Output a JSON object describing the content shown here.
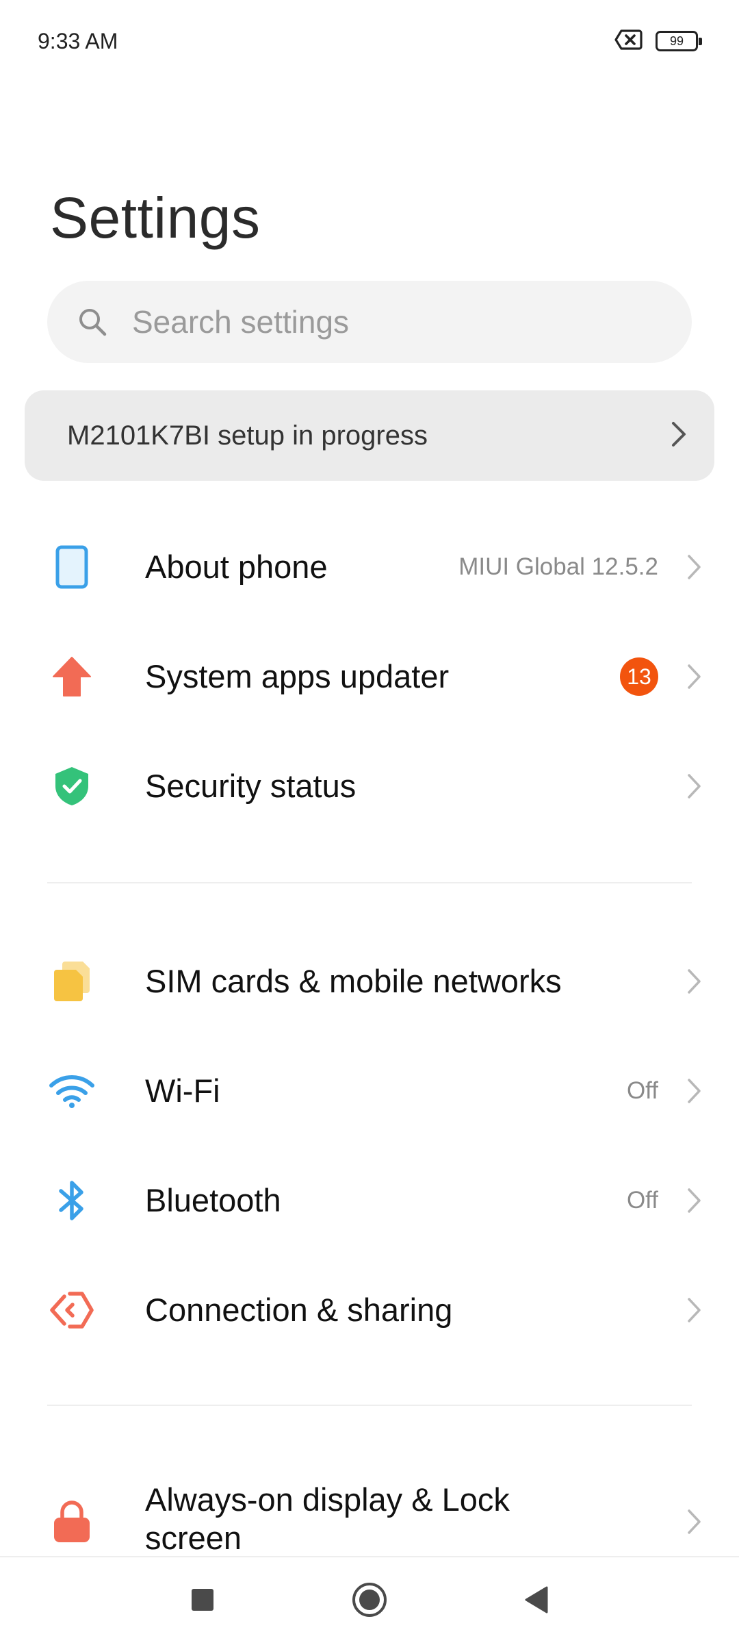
{
  "status_bar": {
    "time": "9:33 AM",
    "battery_level": "99",
    "icons": [
      "no-sim-icon",
      "battery-icon"
    ]
  },
  "header": {
    "title": "Settings"
  },
  "search": {
    "placeholder": "Search settings",
    "value": ""
  },
  "setup_banner": {
    "text": "M2101K7BI setup in progress"
  },
  "sections": [
    {
      "items": [
        {
          "label": "About phone",
          "value": "MIUI Global 12.5.2",
          "icon": "phone-icon",
          "icon_color": "#3aa0e8"
        },
        {
          "label": "System apps updater",
          "badge": "13",
          "icon": "arrow-up-icon",
          "icon_color": "#f26b55"
        },
        {
          "label": "Security status",
          "icon": "shield-check-icon",
          "icon_color": "#34c27a"
        }
      ]
    },
    {
      "items": [
        {
          "label": "SIM cards & mobile networks",
          "icon": "sim-card-icon",
          "icon_color": "#f6c342"
        },
        {
          "label": "Wi-Fi",
          "value": "Off",
          "icon": "wifi-icon",
          "icon_color": "#3aa0e8"
        },
        {
          "label": "Bluetooth",
          "value": "Off",
          "icon": "bluetooth-icon",
          "icon_color": "#3aa0e8"
        },
        {
          "label": "Connection & sharing",
          "icon": "connection-sharing-icon",
          "icon_color": "#f26b55"
        }
      ]
    },
    {
      "items": [
        {
          "label_line1": "Always-on display & Lock",
          "label_line2": "screen",
          "icon": "lock-icon",
          "icon_color": "#f26b55"
        }
      ]
    }
  ],
  "nav_bar": {
    "buttons": [
      "recents-button",
      "home-button",
      "back-button"
    ]
  },
  "colors": {
    "badge": "#f2540e",
    "chevron": "#b8b8b8"
  }
}
